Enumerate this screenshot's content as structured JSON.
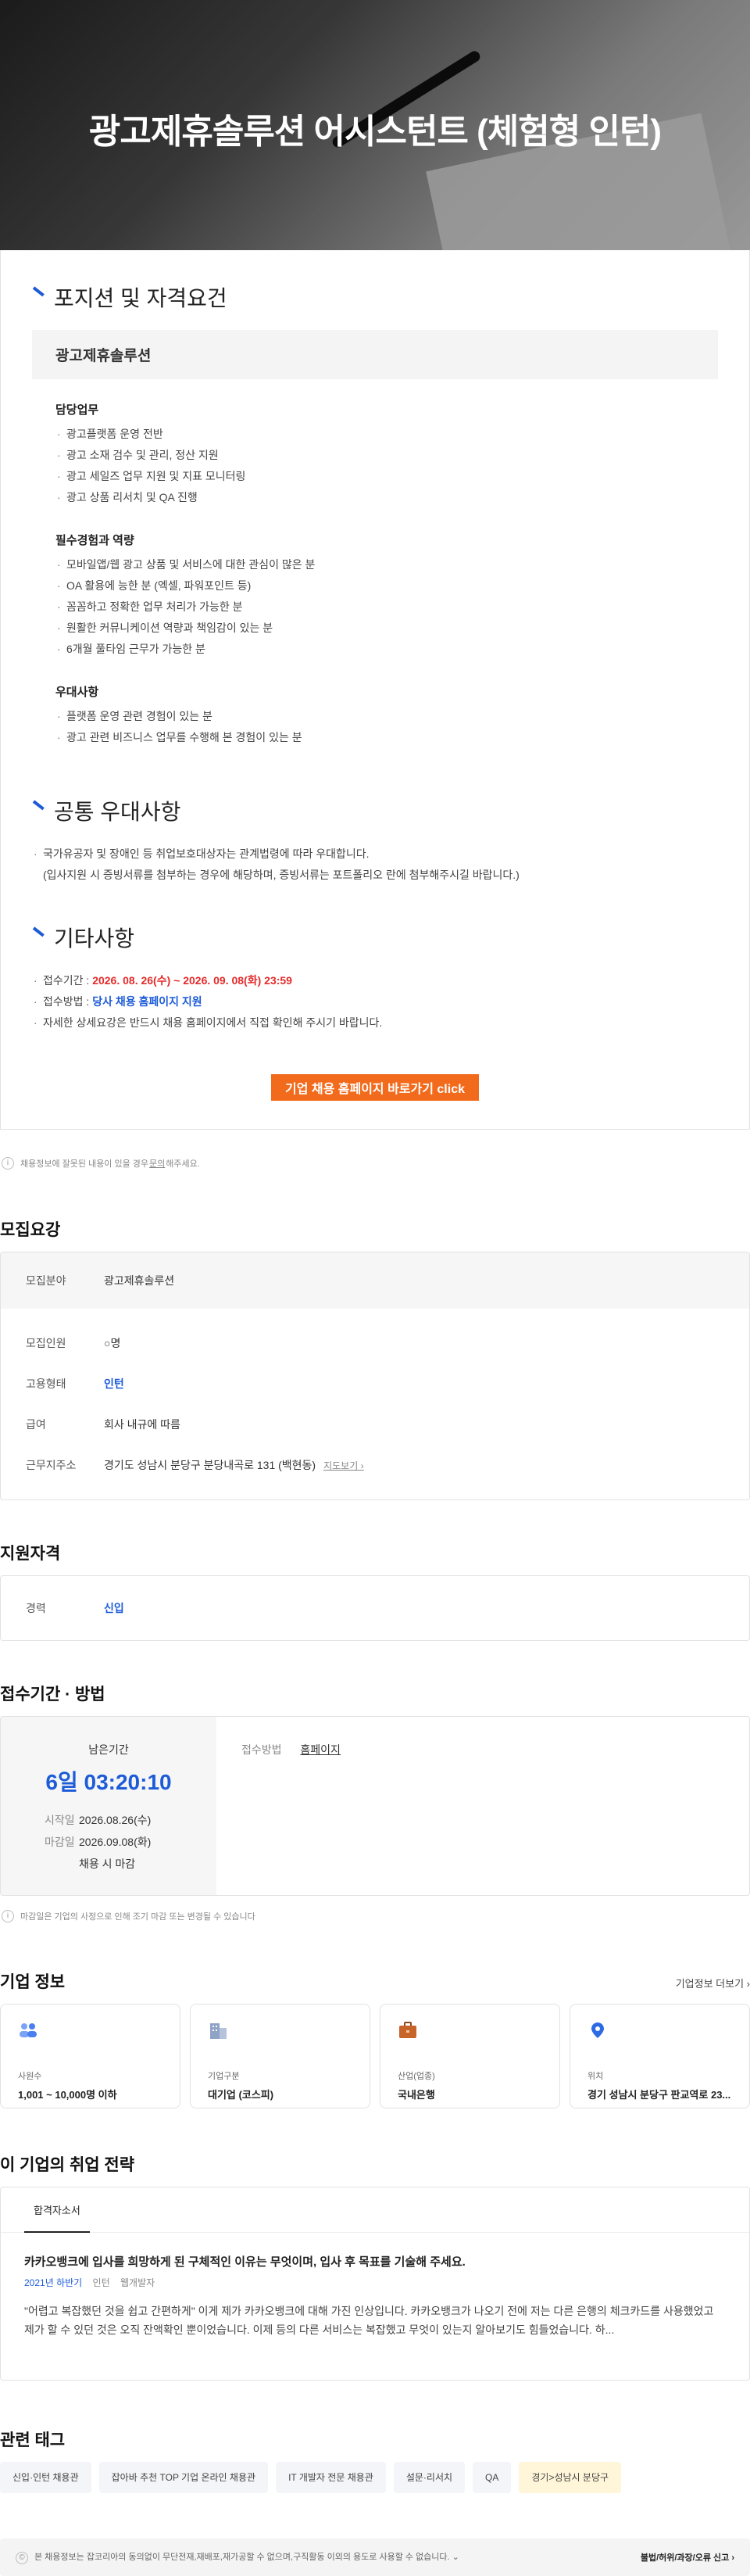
{
  "hero": {
    "title": "광고제휴솔루션 어시스턴트 (체험형 인턴)"
  },
  "detail": {
    "position_heading": "포지션 및 자격요건",
    "position_name": "광고제휴솔루션",
    "duties_title": "담당업무",
    "duties": [
      "광고플랫폼 운영 전반",
      "광고 소재 검수 및 관리, 정산 지원",
      "광고 세일즈 업무 지원 및 지표 모니터링",
      "광고 상품 리서치 및 QA 진행"
    ],
    "required_title": "필수경험과 역량",
    "required": [
      "모바일앱/웹 광고 상품 및 서비스에 대한 관심이 많은 분",
      "OA 활용에 능한 분 (엑셀, 파워포인트 등)",
      "꼼꼼하고 정확한 업무 처리가 가능한 분",
      "원활한 커뮤니케이션 역량과 책임감이 있는 분",
      "6개월 풀타임 근무가 가능한 분"
    ],
    "preferred_title": "우대사항",
    "preferred": [
      "플랫폼 운영 관련 경험이 있는 분",
      "광고 관련 비즈니스 업무를 수행해 본 경험이 있는 분"
    ],
    "common_heading": "공통 우대사항",
    "common_line1": "국가유공자 및 장애인 등 취업보호대상자는 관계법령에 따라 우대합니다.",
    "common_line2": "(입사지원 시 증빙서류를 첨부하는 경우에 해당하며, 증빙서류는 포트폴리오 란에 첨부해주시길 바랍니다.)",
    "etc_heading": "기타사항",
    "etc_period_label": "접수기간 : ",
    "etc_period_value": "2026. 08. 26(수) ~ 2026. 09. 08(화) 23:59",
    "etc_method_label": "접수방법 : ",
    "etc_method_value": "당사 채용 홈페이지 지원",
    "etc_note": "자세한 상세요강은 반드시 채용 홈페이지에서 직접 확인해 주시기 바랍니다.",
    "cta_label": "기업 채용 홈페이지 바로가기 click"
  },
  "notice": {
    "prefix": "채용정보에 잘못된 내용이 있을 경우 ",
    "link": "문의",
    "suffix": "해주세요."
  },
  "recruit": {
    "title": "모집요강",
    "field_label": "모집분야",
    "field_value": "광고제휴솔루션",
    "count_label": "모집인원",
    "count_value": "○명",
    "type_label": "고용형태",
    "type_value": "인턴",
    "salary_label": "급여",
    "salary_value": "회사 내규에 따름",
    "location_label": "근무지주소",
    "location_value": "경기도 성남시 분당구 분당내곡로 131 (백현동)",
    "map_label": "지도보기 ›"
  },
  "qualification": {
    "title": "지원자격",
    "career_label": "경력",
    "career_value": "신입"
  },
  "apply": {
    "title": "접수기간 · 방법",
    "remaining_label": "남은기간",
    "countdown": "6일 03:20:10",
    "start_label": "시작일",
    "start_value": "2026.08.26(수)",
    "end_label": "마감일",
    "end_value": "2026.09.08(화)",
    "end_note": "채용 시 마감",
    "method_label": "접수방법",
    "method_value": "홈페이지",
    "notice": "마감일은 기업의 사정으로 인해 조기 마감 또는 변경될 수 있습니다"
  },
  "company": {
    "title": "기업 정보",
    "more": "기업정보 더보기 ›",
    "cards": [
      {
        "label": "사원수",
        "value": "1,001 ~ 10,000명 이하",
        "icon": "people-icon",
        "color": "#4a7ff0"
      },
      {
        "label": "기업구분",
        "value": "대기업 (코스피)",
        "icon": "building-icon",
        "color": "#8fa3c7"
      },
      {
        "label": "산업(업종)",
        "value": "국내은행",
        "icon": "briefcase-icon",
        "color": "#c7642a"
      },
      {
        "label": "위치",
        "value": "경기 성남시 분당구 판교역로 23...",
        "icon": "location-pin-icon",
        "color": "#2d6be4"
      }
    ]
  },
  "strategy": {
    "title": "이 기업의 취업 전략",
    "tab": "합격자소서",
    "question": "카카오뱅크에 입사를 희망하게 된 구체적인 이유는 무엇이며, 입사 후 목표를 기술해 주세요.",
    "year": "2021년 하반기",
    "kind": "인턴",
    "job": "웹개발자",
    "answer": "\"어렵고 복잡했던 것을 쉽고 간편하게\" 이게 제가 카카오뱅크에 대해 가진 인상입니다. 카카오뱅크가 나오기 전에 저는 다른 은행의 체크카드를 사용했었고 제가 할 수 있던 것은 오직 잔액확인 뿐이었습니다. 이제 등의 다른 서비스는 복잡했고 무엇이 있는지 알아보기도 힘들었습니다. 하..."
  },
  "tags": {
    "title": "관련 태그",
    "items": [
      "신입·인턴 채용관",
      "잡아바 추천 TOP 기업 온라인 채용관",
      "IT 개발자 전문 채용관",
      "설문·리서치",
      "QA",
      "경기>성남시 분당구"
    ]
  },
  "footer": {
    "copyright": "본 채용정보는 잡코리아의 동의없이 무단전재,재배포,재가공할 수 없으며,구직활동 이외의 용도로 사용할 수 없습니다.",
    "report": "불법/허위/과장/오류 신고 ›"
  }
}
